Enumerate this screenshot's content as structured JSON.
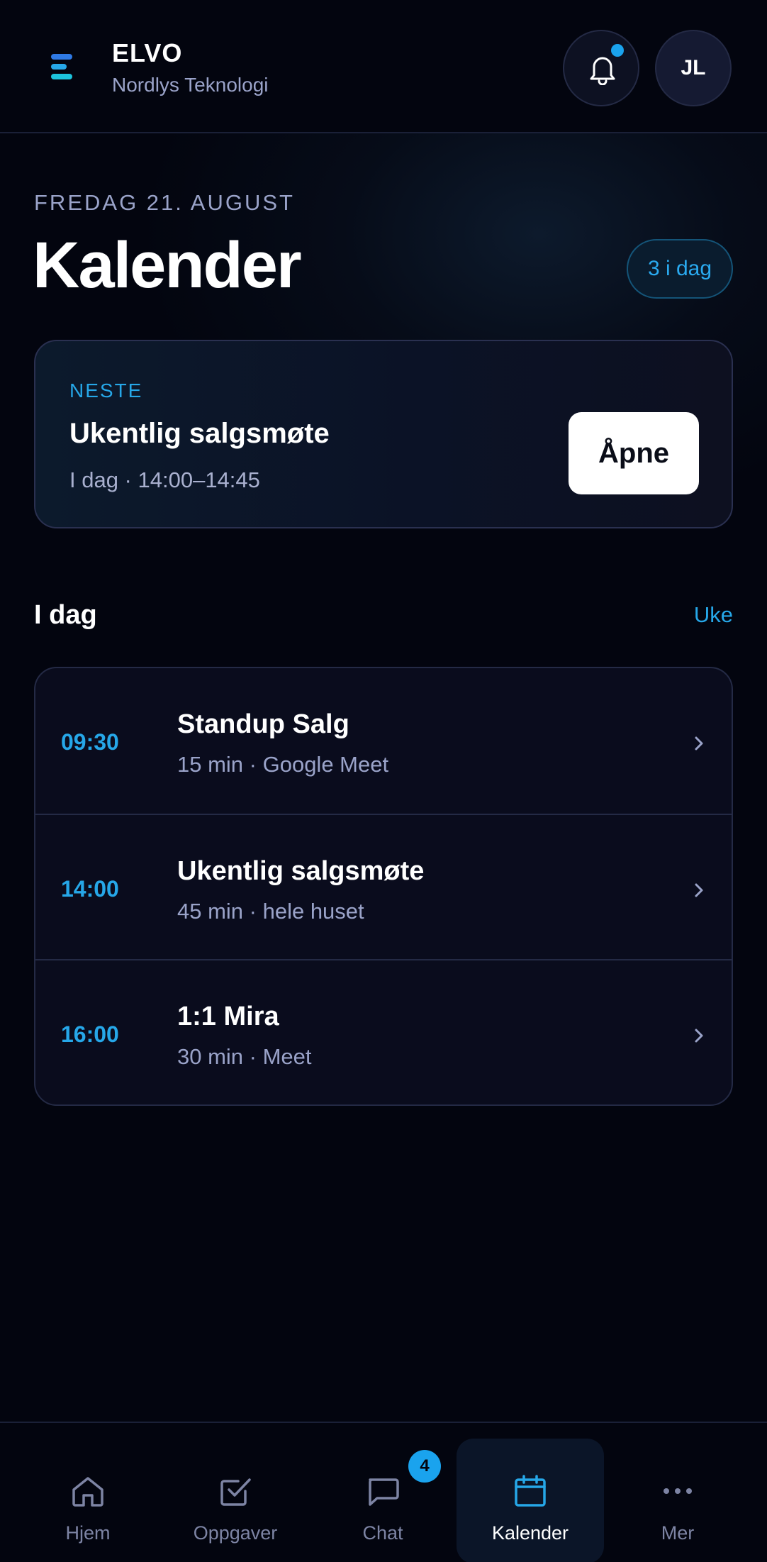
{
  "header": {
    "brand": "ELVO",
    "org": "Nordlys Teknologi",
    "avatar_initials": "JL",
    "notification_dot": true
  },
  "page": {
    "date_label": "FREDAG 21. AUGUST",
    "title": "Kalender",
    "today_badge": "3 i dag"
  },
  "next": {
    "label": "NESTE",
    "title": "Ukentlig salgsmøte",
    "time": "I dag · 14:00–14:45",
    "open_label": "Åpne"
  },
  "section": {
    "title": "I dag",
    "link": "Uke"
  },
  "events": [
    {
      "time": "09:30",
      "title": "Standup Salg",
      "meta": "15 min · Google Meet"
    },
    {
      "time": "14:00",
      "title": "Ukentlig salgsmøte",
      "meta": "45 min · hele huset"
    },
    {
      "time": "16:00",
      "title": "1:1 Mira",
      "meta": "30 min · Meet"
    }
  ],
  "nav": {
    "items": [
      {
        "label": "Hjem",
        "icon": "home-icon"
      },
      {
        "label": "Oppgaver",
        "icon": "checkbox-icon"
      },
      {
        "label": "Chat",
        "icon": "chat-icon",
        "badge": "4"
      },
      {
        "label": "Kalender",
        "icon": "calendar-icon",
        "active": true
      },
      {
        "label": "Mer",
        "icon": "more-icon"
      }
    ]
  },
  "colors": {
    "accent": "#26a7e8",
    "background": "#03050f",
    "muted_text": "#9aa3c9"
  }
}
